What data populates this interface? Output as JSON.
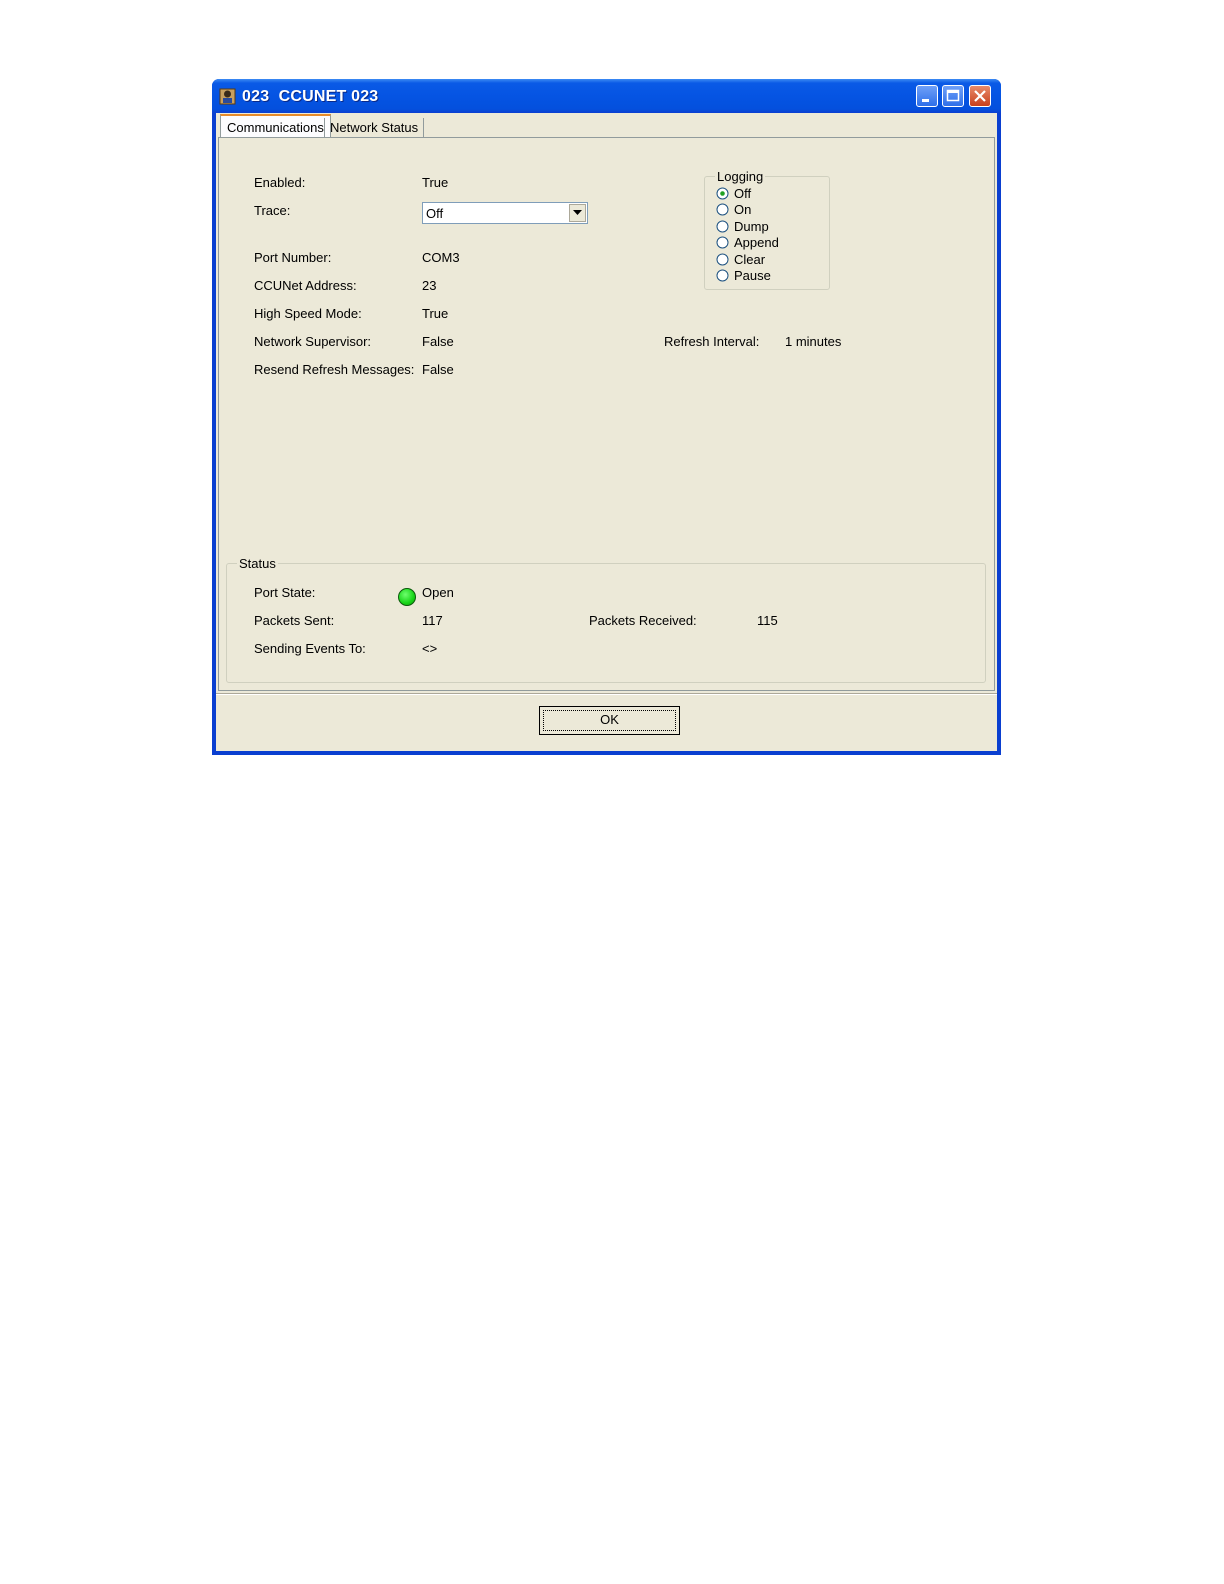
{
  "window": {
    "title": "023  CCUNET 023"
  },
  "tabs": [
    {
      "label": "Communications"
    },
    {
      "label": "Network Status"
    }
  ],
  "fields": {
    "enabled": {
      "label": "Enabled:",
      "value": "True"
    },
    "trace": {
      "label": "Trace:",
      "value": "Off"
    },
    "port_number": {
      "label": "Port Number:",
      "value": "COM3"
    },
    "ccunet_address": {
      "label": "CCUNet Address:",
      "value": "23"
    },
    "high_speed_mode": {
      "label": "High Speed Mode:",
      "value": "True"
    },
    "network_supervisor": {
      "label": "Network Supervisor:",
      "value": "False"
    },
    "resend_refresh": {
      "label": "Resend Refresh Messages:",
      "value": "False"
    },
    "refresh_interval": {
      "label": "Refresh Interval:",
      "value": "1 minutes"
    }
  },
  "logging": {
    "title": "Logging",
    "selected": "Off",
    "options": [
      "Off",
      "On",
      "Dump",
      "Append",
      "Clear",
      "Pause"
    ]
  },
  "status": {
    "title": "Status",
    "port_state": {
      "label": "Port State:",
      "value": "Open",
      "indicator_color": "#18d418"
    },
    "packets_sent": {
      "label": "Packets Sent:",
      "value": "117"
    },
    "packets_received": {
      "label": "Packets Received:",
      "value": "115"
    },
    "sending_events_to": {
      "label": "Sending Events To:",
      "value": "<>"
    }
  },
  "buttons": {
    "ok": "OK"
  },
  "colors": {
    "title_bar": "#0554e3",
    "window_bg": "#ece9d8",
    "status_led": "#18d418"
  }
}
